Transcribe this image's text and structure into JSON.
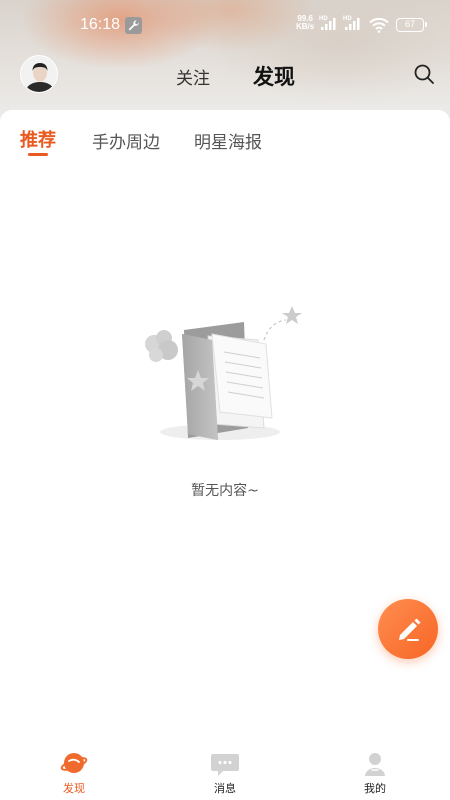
{
  "status_bar": {
    "time": "16:18",
    "net_speed_top": "99.6",
    "net_speed_bottom": "KB/s",
    "battery": "67",
    "hd_label": "HD"
  },
  "header": {
    "tabs": [
      {
        "label": "关注",
        "active": false
      },
      {
        "label": "发现",
        "active": true
      }
    ],
    "icons": [
      "avatar",
      "search-icon"
    ]
  },
  "categories": [
    {
      "label": "推荐",
      "active": true
    },
    {
      "label": "手办周边",
      "active": false
    },
    {
      "label": "明星海报",
      "active": false
    }
  ],
  "empty_state": {
    "text": "暂无内容~",
    "icon": "empty-folder-illustration"
  },
  "fab": {
    "icon": "pencil-icon"
  },
  "bottom_nav": [
    {
      "label": "发现",
      "icon": "planet-icon",
      "active": true
    },
    {
      "label": "消息",
      "icon": "message-icon",
      "active": false
    },
    {
      "label": "我的",
      "icon": "profile-icon",
      "active": false
    }
  ],
  "colors": {
    "accent": "#ea5a20",
    "fab": "#f76625",
    "text": "#333333"
  }
}
